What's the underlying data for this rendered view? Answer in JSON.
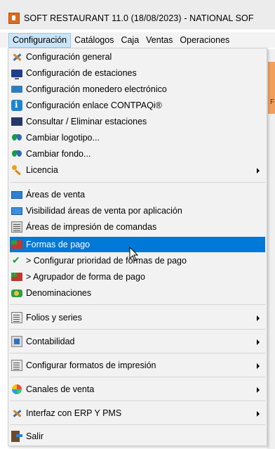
{
  "window": {
    "title": "SOFT RESTAURANT  11.0 (18/08/2023) -  NATIONAL SOF"
  },
  "menubar": {
    "items": [
      "Configuración",
      "Catálogos",
      "Caja",
      "Ventas",
      "Operaciones"
    ]
  },
  "background": {
    "partial_text": "F"
  },
  "dropdown": {
    "items": [
      {
        "label": "Configuración general",
        "icon": "tools-icon"
      },
      {
        "label": "Configuración de estaciones",
        "icon": "monitor-icon"
      },
      {
        "label": "Configuración monedero electrónico",
        "icon": "wallet-icon"
      },
      {
        "label": "Configuración enlace CONTPAQi®",
        "icon": "contpaqi-icon"
      },
      {
        "label": "Consultar / Eliminar estaciones",
        "icon": "stations-icon"
      },
      {
        "label": "Cambiar logotipo...",
        "icon": "butterfly-icon"
      },
      {
        "label": "Cambiar fondo...",
        "icon": "butterfly-icon"
      },
      {
        "label": "Licencia",
        "icon": "key-icon",
        "submenu": true
      },
      {
        "label": "Áreas de venta",
        "icon": "screen-icon"
      },
      {
        "label": "Visibilidad áreas de venta por aplicación",
        "icon": "screen-icon"
      },
      {
        "label": "Áreas de impresión de comandas",
        "icon": "printer-icon"
      },
      {
        "label": "Formas de pago",
        "icon": "money-icon",
        "highlighted": true
      },
      {
        "label": " > Configurar prioridad de formas de pago",
        "icon": "check-icon"
      },
      {
        "label": " > Agrupador de forma de pago",
        "icon": "money-icon"
      },
      {
        "label": "Denominaciones",
        "icon": "coins-icon"
      },
      {
        "label": "Folios y series",
        "icon": "document-icon",
        "submenu": true
      },
      {
        "label": "Contabilidad",
        "icon": "book-icon",
        "submenu": true
      },
      {
        "label": "Configurar formatos de impresión",
        "icon": "document-icon",
        "submenu": true
      },
      {
        "label": "Canales de venta",
        "icon": "flower-icon",
        "submenu": true
      },
      {
        "label": "Interfaz con ERP Y PMS",
        "icon": "tools-icon",
        "submenu": true
      },
      {
        "label": "Salir",
        "icon": "exit-icon"
      }
    ]
  },
  "colors": {
    "highlight": "#0078d7",
    "menu_background": "#f2f2f2",
    "active_menu": "#cce4f7"
  }
}
